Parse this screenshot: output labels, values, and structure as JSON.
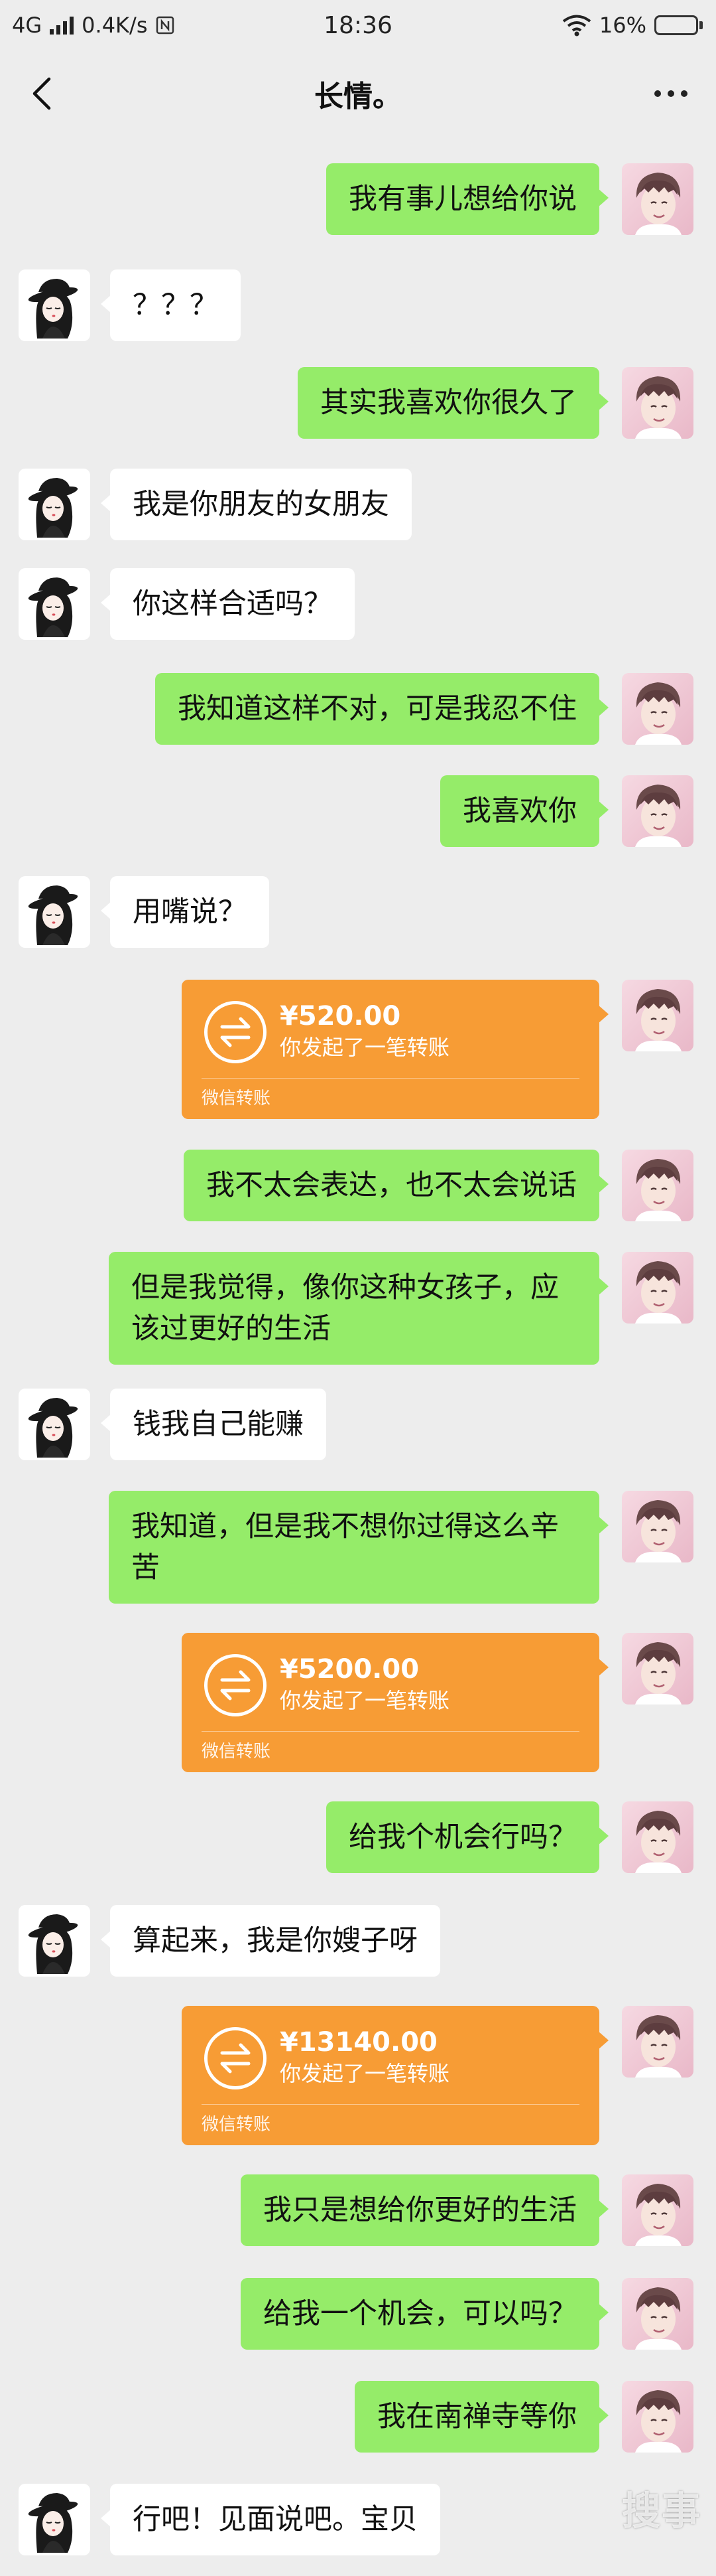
{
  "status_bar": {
    "network": "4G",
    "speed": "0.4K/s",
    "time": "18:36",
    "battery_text": "16%",
    "battery_level": 0.16
  },
  "header": {
    "title": "长情。"
  },
  "messages": [
    {
      "type": "text",
      "side": "right",
      "text": "我有事儿想给你说"
    },
    {
      "type": "text",
      "side": "left",
      "text": "？？？"
    },
    {
      "type": "text",
      "side": "right",
      "text": "其实我喜欢你很久了"
    },
    {
      "type": "text",
      "side": "left",
      "text": "我是你朋友的女朋友"
    },
    {
      "type": "text",
      "side": "left",
      "text": "你这样合适吗？"
    },
    {
      "type": "text",
      "side": "right",
      "text": "我知道这样不对，可是我忍不住"
    },
    {
      "type": "text",
      "side": "right",
      "text": "我喜欢你"
    },
    {
      "type": "text",
      "side": "left",
      "text": "用嘴说？"
    },
    {
      "type": "transfer",
      "side": "right",
      "amount": "¥520.00",
      "desc": "你发起了一笔转账",
      "footer": "微信转账"
    },
    {
      "type": "text",
      "side": "right",
      "text": "我不太会表达，也不太会说话"
    },
    {
      "type": "text",
      "side": "right",
      "text": "但是我觉得，像你这种女孩子，应该过更好的生活"
    },
    {
      "type": "text",
      "side": "left",
      "text": "钱我自己能赚"
    },
    {
      "type": "text",
      "side": "right",
      "text": "我知道，但是我不想你过得这么辛苦"
    },
    {
      "type": "transfer",
      "side": "right",
      "amount": "¥5200.00",
      "desc": "你发起了一笔转账",
      "footer": "微信转账"
    },
    {
      "type": "text",
      "side": "right",
      "text": "给我个机会行吗？"
    },
    {
      "type": "text",
      "side": "left",
      "text": "算起来，我是你嫂子呀"
    },
    {
      "type": "transfer",
      "side": "right",
      "amount": "¥13140.00",
      "desc": "你发起了一笔转账",
      "footer": "微信转账"
    },
    {
      "type": "text",
      "side": "right",
      "text": "我只是想给你更好的生活"
    },
    {
      "type": "text",
      "side": "right",
      "text": "给我一个机会，可以吗？"
    },
    {
      "type": "text",
      "side": "right",
      "text": "我在南禅寺等你"
    },
    {
      "type": "text",
      "side": "left",
      "text": "行吧！见面说吧。宝贝"
    }
  ],
  "watermark": "搜事"
}
